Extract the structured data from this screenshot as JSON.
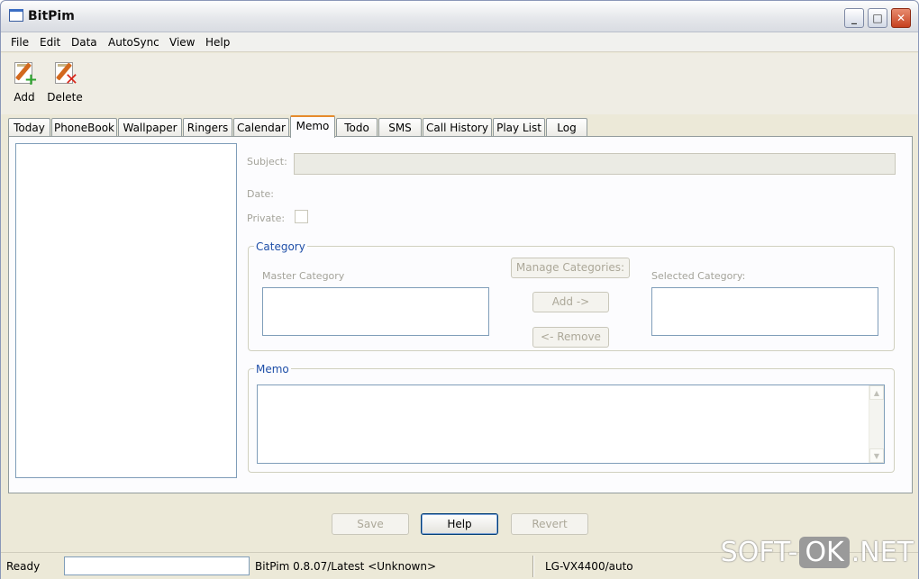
{
  "window": {
    "title": "BitPim"
  },
  "menu": [
    "File",
    "Edit",
    "Data",
    "AutoSync",
    "View",
    "Help"
  ],
  "toolbar": {
    "add_label": "Add",
    "delete_label": "Delete"
  },
  "tabs": [
    "Today",
    "PhoneBook",
    "Wallpaper",
    "Ringers",
    "Calendar",
    "Memo",
    "Todo",
    "SMS",
    "Call History",
    "Play List",
    "Log"
  ],
  "active_tab": "Memo",
  "form": {
    "subject_label": "Subject:",
    "subject_value": "",
    "date_label": "Date:",
    "private_label": "Private:",
    "private_checked": false
  },
  "category": {
    "title": "Category",
    "master_label": "Master Category",
    "manage_button": "Manage Categories:",
    "add_button": "Add ->",
    "remove_button": "<- Remove",
    "selected_label": "Selected Category:"
  },
  "memo": {
    "title": "Memo",
    "value": ""
  },
  "buttons": {
    "save": "Save",
    "help": "Help",
    "revert": "Revert"
  },
  "status": {
    "ready": "Ready",
    "version": "BitPim 0.8.07/Latest <Unknown>",
    "device": "LG-VX4400/auto"
  },
  "watermark": {
    "left": "SOFT-",
    "middle": "OK",
    "right": ".NET"
  }
}
